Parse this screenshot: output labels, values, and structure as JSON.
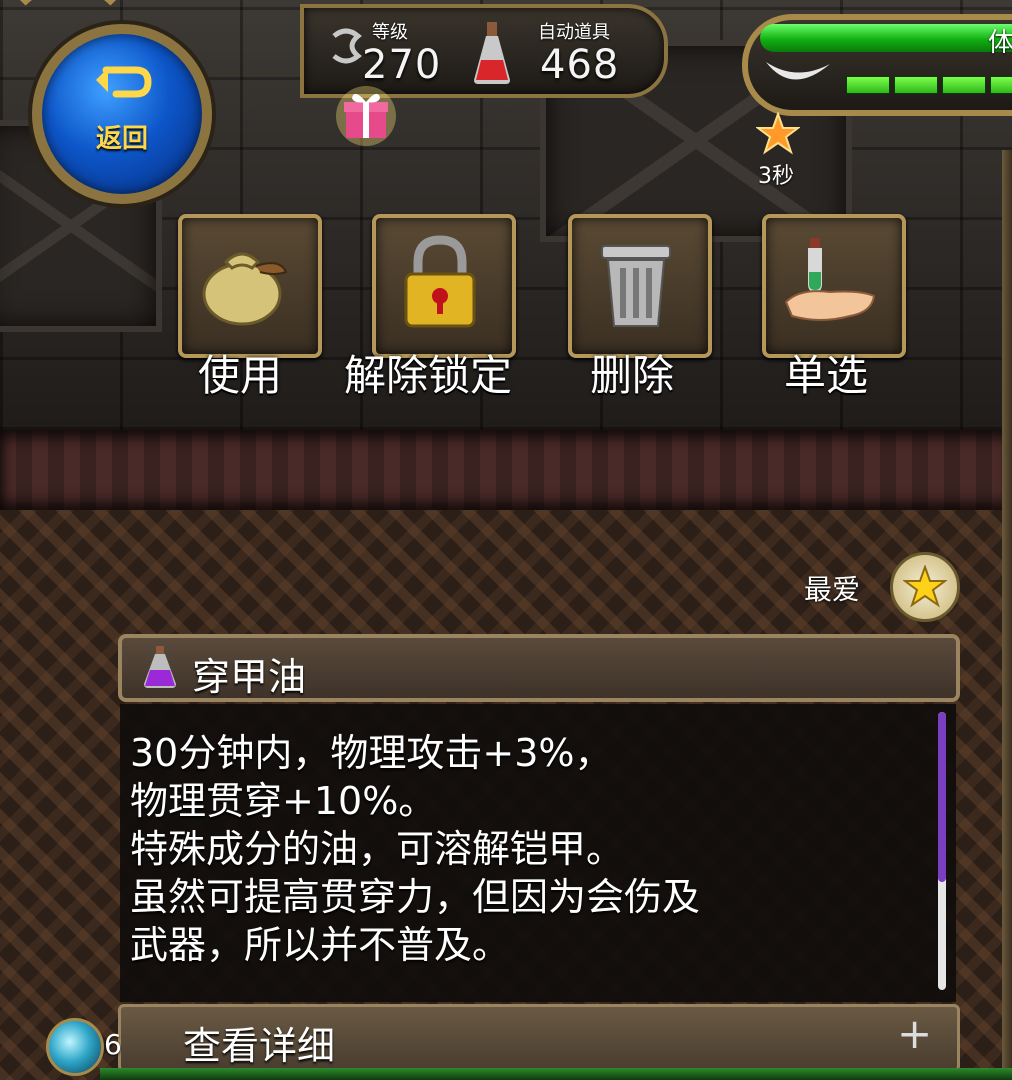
{
  "hud": {
    "back_label": "返回",
    "level_label": "等级",
    "level_value": "270",
    "auto_item_label": "自动道具",
    "auto_item_value": "468",
    "hp_label": "体",
    "buff_timer": "3秒",
    "orb_count": "6"
  },
  "actions": [
    {
      "label": "使用",
      "icon": "bag-icon"
    },
    {
      "label": "解除锁定",
      "icon": "lock-icon"
    },
    {
      "label": "删除",
      "icon": "trash-icon"
    },
    {
      "label": "单选",
      "icon": "hand-icon"
    }
  ],
  "favorite": {
    "label": "最爱",
    "icon": "star-icon"
  },
  "item": {
    "name": "穿甲油",
    "icon": "potion-icon",
    "description": [
      "30分钟内，物理攻击+3%，",
      "物理贯穿+10%。",
      "特殊成分的油，可溶解铠甲。",
      "虽然可提高贯穿力，但因为会伤及",
      "武器，所以并不普及。"
    ],
    "detail_label": "查看详细",
    "detail_icon": "plus-icon"
  },
  "colors": {
    "gold": "#a88a4a",
    "hp_green": "#12b012",
    "back_blue": "#0d56c9",
    "scroll_purple": "#7a3fc0"
  }
}
